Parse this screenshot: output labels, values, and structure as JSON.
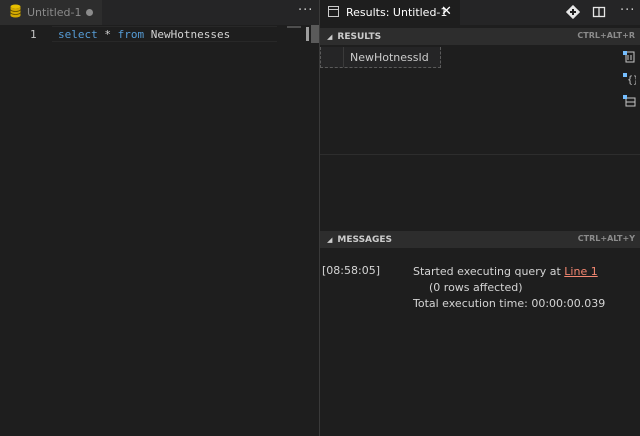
{
  "editor": {
    "tab": {
      "title": "Untitled-1",
      "icon": "database-icon",
      "dirty": true
    },
    "more_label": "···",
    "line_number": "1",
    "code": {
      "kw1": "select",
      "op": " * ",
      "kw2": "from",
      "table": " NewHotnesses"
    }
  },
  "results_pane": {
    "tab": {
      "title": "Results: Untitled-1",
      "close_label": "✕"
    },
    "actions": [
      "run-query-icon",
      "split-editor-icon",
      "more-icon"
    ],
    "more_label": "···",
    "results_section": {
      "title": "RESULTS",
      "shortcut": "CTRL+ALT+R",
      "columns": [
        "NewHotnessId"
      ],
      "side_actions": [
        "save-csv-icon",
        "save-json-icon",
        "save-excel-icon"
      ]
    },
    "messages_section": {
      "title": "MESSAGES",
      "shortcut": "CTRL+ALT+Y",
      "timestamp": "[08:58:05]",
      "line1_prefix": "Started executing query at ",
      "line1_link": "Line 1",
      "line2": "(0 rows affected)",
      "line3": "Total execution time: 00:00:00.039"
    }
  },
  "colors": {
    "keyword": "#569cd6",
    "link": "#f48771",
    "background": "#1e1e1e"
  }
}
